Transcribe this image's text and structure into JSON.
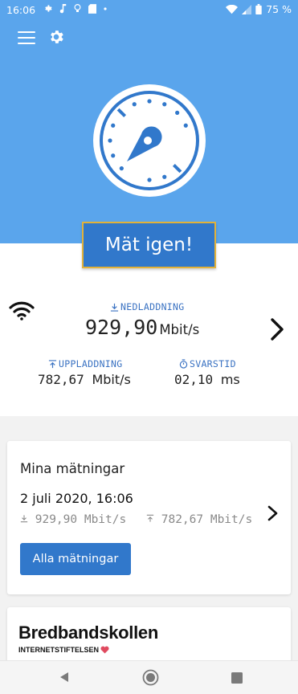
{
  "status_bar": {
    "time": "16:06",
    "battery": "75 %"
  },
  "main": {
    "measure_button": "Mät igen!"
  },
  "results": {
    "download": {
      "label": "NEDLADDNING",
      "value": "929,90",
      "unit": "Mbit/s"
    },
    "upload": {
      "label": "UPPLADDNING",
      "value": "782,67",
      "unit": "Mbit/s"
    },
    "latency": {
      "label": "SVARSTID",
      "value": "02,10",
      "unit": "ms"
    }
  },
  "measurements_card": {
    "title": "Mina mätningar",
    "date": "2 juli 2020, 16:06",
    "download": "929,90 Mbit/s",
    "upload": "782,67 Mbit/s",
    "button": "Alla mätningar"
  },
  "brand": {
    "name": "Bredbandskollen",
    "subtitle": "INTERNETSTIFTELSEN"
  },
  "colors": {
    "header_blue": "#5aa5ec",
    "button_blue": "#3178cb",
    "button_border": "#e2b239",
    "accent_label": "#3a72c2",
    "heart": "#e04a5f"
  },
  "icons": [
    "gear-icon",
    "music-note-icon",
    "lightbulb-icon",
    "sd-card-icon",
    "dot-icon",
    "wifi-icon",
    "signal-icon",
    "battery-icon",
    "menu-icon",
    "settings-icon",
    "speedometer-icon",
    "download-arrow-icon",
    "upload-arrow-icon",
    "stopwatch-icon",
    "chevron-right-icon",
    "heart-icon",
    "back-icon",
    "home-icon",
    "recent-apps-icon"
  ]
}
